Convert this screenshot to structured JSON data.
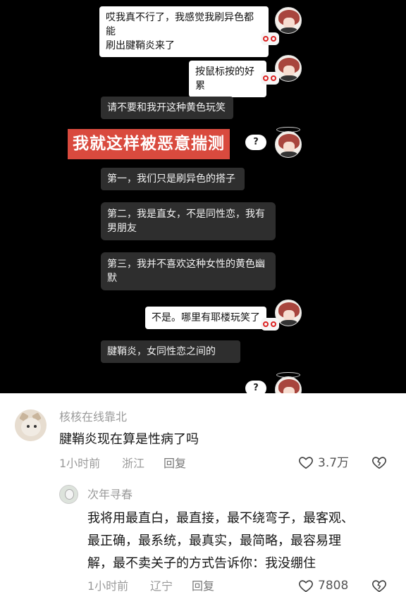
{
  "chat": {
    "messages": [
      {
        "side": "right",
        "lines": [
          "哎我真不行了，我感觉我刷异色都能",
          "刷出腱鞘炎来了"
        ]
      },
      {
        "side": "right",
        "lines": [
          "按鼠标按的好累"
        ]
      },
      {
        "side": "left",
        "lines": [
          "请不要和我开这种黄色玩笑"
        ]
      },
      {
        "side": "left",
        "lines": [
          "第一，我们只是刷异色的搭子"
        ]
      },
      {
        "side": "left",
        "lines": [
          "第二，我是直女，不是同性恋，我有",
          "男朋友"
        ]
      },
      {
        "side": "left",
        "lines": [
          "第三，我并不喜欢这种女性的黄色幽",
          "默"
        ]
      },
      {
        "side": "right",
        "lines": [
          "不是。哪里有耶楼玩笑了"
        ]
      },
      {
        "side": "left",
        "lines": [
          "腱鞘炎，女同性恋之间的"
        ]
      }
    ],
    "banner": "我就这样被恶意揣测",
    "question_mark": "?"
  },
  "comments": [
    {
      "username": "核核在线靠北",
      "text": "腱鞘炎现在算是性病了吗",
      "time": "1小时前",
      "location": "浙江",
      "reply_label": "回复",
      "likes": "3.7万"
    },
    {
      "username": "次年寻春",
      "lines": [
        "我将用最直白，最直接，最不绕弯子，最客观、",
        "最正确，最系统，最真实，最简略，最容易理",
        "解，最不卖关子的方式告诉你：我没绷住"
      ],
      "time": "1小时前",
      "location": "辽宁",
      "reply_label": "回复",
      "likes": "7808"
    }
  ],
  "icons": {
    "like": "heart-outline-icon",
    "dislike": "broken-heart-icon"
  }
}
